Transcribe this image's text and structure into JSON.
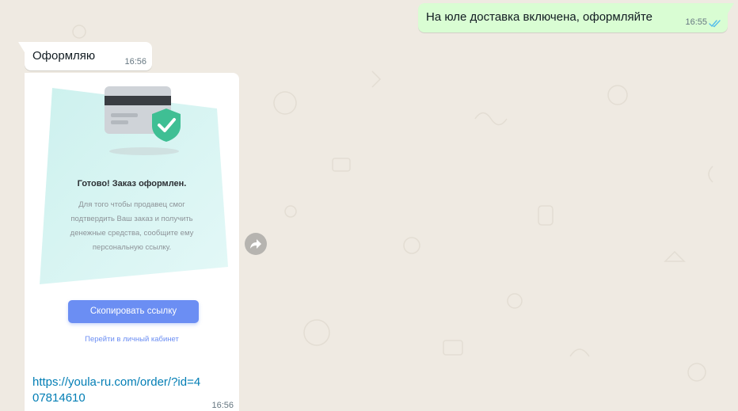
{
  "messages": {
    "outgoing": {
      "text": "На юле доставка включена, оформляйте",
      "time": "16:55",
      "status_icon": "double-check-read-icon"
    },
    "incoming_1": {
      "text": "Оформляю",
      "time": "16:56"
    },
    "incoming_2": {
      "preview": {
        "title": "Готово! Заказ оформлен.",
        "description": "Для того чтобы продавец смог\nподтвердить Ваш заказ и получить\nденежные средства, сообщите ему\nперсональную ссылку.",
        "copy_button_label": "Скопировать ссылку",
        "cabinet_link_label": "Перейти в личный кабинет",
        "illustration": "credit-card-shield-icon"
      },
      "link_text": "https://youla-ru.com/order/?id=407814610",
      "time": "16:56"
    }
  },
  "forward_icon": "forward-arrow-icon",
  "colors": {
    "chat_background": "#efeae2",
    "outgoing_bubble": "#d9fdd3",
    "incoming_bubble": "#ffffff",
    "read_ticks": "#53bdeb",
    "link": "#027eb5",
    "accent_button": "#6b8ef3",
    "panel_tint": "#cdf1ee"
  }
}
